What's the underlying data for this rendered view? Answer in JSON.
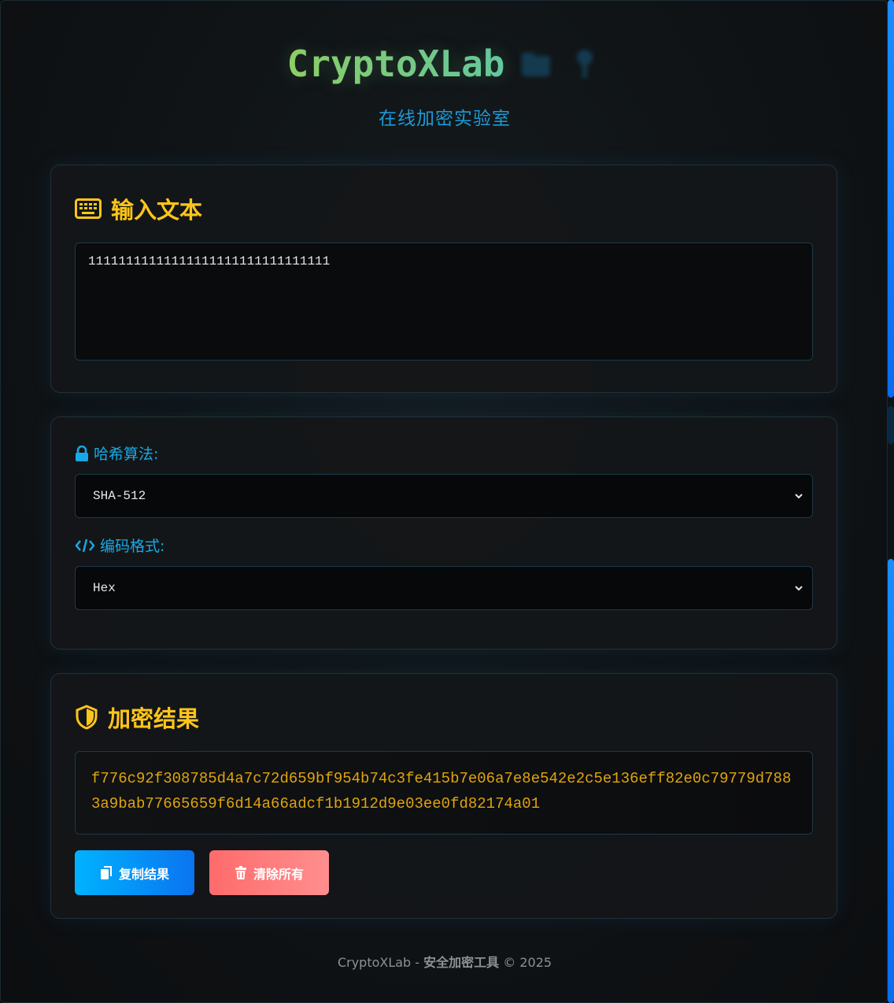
{
  "header": {
    "title": "CryptoXLab",
    "subtitle": "在线加密实验室"
  },
  "input_card": {
    "heading": "输入文本",
    "heading_icon": "keyboard-icon",
    "text_value": "11111111111111111111111111111111"
  },
  "settings_card": {
    "algorithm_label": "哈希算法:",
    "algorithm_icon": "lock-icon",
    "algorithm_value": "SHA-512",
    "encoding_label": "编码格式:",
    "encoding_icon": "code-icon",
    "encoding_value": "Hex"
  },
  "result_card": {
    "heading": "加密结果",
    "heading_icon": "shield-icon",
    "result_value": "f776c92f308785d4a7c72d659bf954b74c3fe415b7e06a7e8e542e2c5e136eff82e0c79779d7883a9bab77665659f6d14a66adcf1b1912d9e03ee0fd82174a01",
    "copy_label": "复制结果",
    "clear_label": "清除所有"
  },
  "footer": {
    "brand": "CryptoXLab - ",
    "strong": "安全加密工具",
    "suffix": " © 2025"
  },
  "colors": {
    "accent_yellow": "#ffc51a",
    "accent_blue": "#17a9e6",
    "result_text": "#e0a40f"
  }
}
